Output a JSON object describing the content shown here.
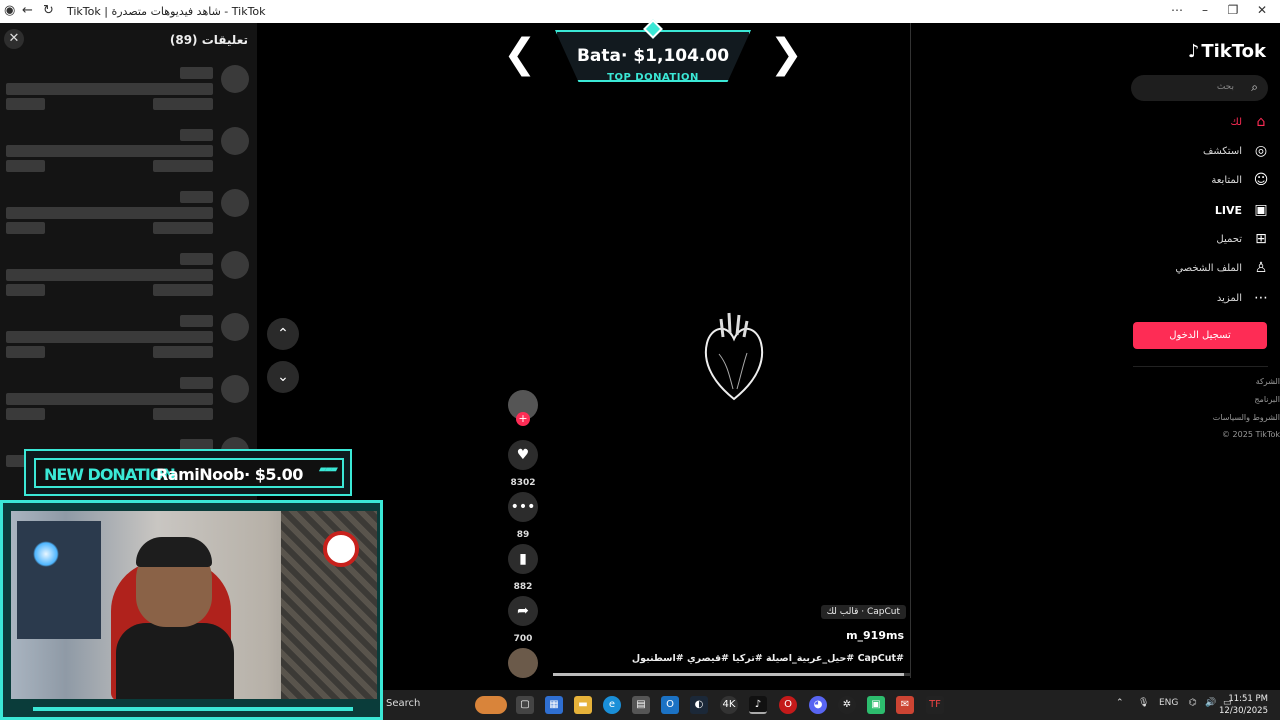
{
  "browser": {
    "title": "TikTok | شاهد فيديوهات متصدرة - TikTok"
  },
  "comments": {
    "title": "تعليقات (89)"
  },
  "video": {
    "capcut_tag": "CapCut · قالب لك",
    "author": "m_919ms",
    "description": "#CapCut #حيل_عربية_اصيلة #تركيا #قيصري #اسطنبول",
    "progress": 0.98
  },
  "actions": {
    "likes": "8302",
    "comments": "89",
    "saves": "882",
    "shares": "700"
  },
  "sidebar": {
    "logo": "TikTok",
    "search_placeholder": "بحث",
    "items": [
      {
        "label": "لك",
        "icon": "home-icon",
        "active": true
      },
      {
        "label": "استكشف",
        "icon": "compass-icon"
      },
      {
        "label": "المتابعة",
        "icon": "following-icon"
      },
      {
        "label": "LIVE",
        "icon": "live-icon"
      },
      {
        "label": "تحميل",
        "icon": "upload-icon"
      },
      {
        "label": "الملف الشخصي",
        "icon": "profile-icon"
      },
      {
        "label": "المزيد",
        "icon": "more-icon"
      }
    ],
    "login": "تسجيل الدخول",
    "footer": [
      "الشركة",
      "البرنامج",
      "الشروط والسياسات",
      "© 2025 TikTok"
    ]
  },
  "overlay": {
    "top_amount": "Bata· $1,104.00",
    "top_label": "TOP DONATION",
    "new_label": "NEW DONATION",
    "new_text": "RamiNoob· $5.00"
  },
  "taskbar": {
    "search": "Search",
    "lang": "ENG",
    "time": "11:51 PM",
    "date": "12/30/2025"
  },
  "colors": {
    "accent": "#fe2c55",
    "overlay": "#3be8d6"
  }
}
